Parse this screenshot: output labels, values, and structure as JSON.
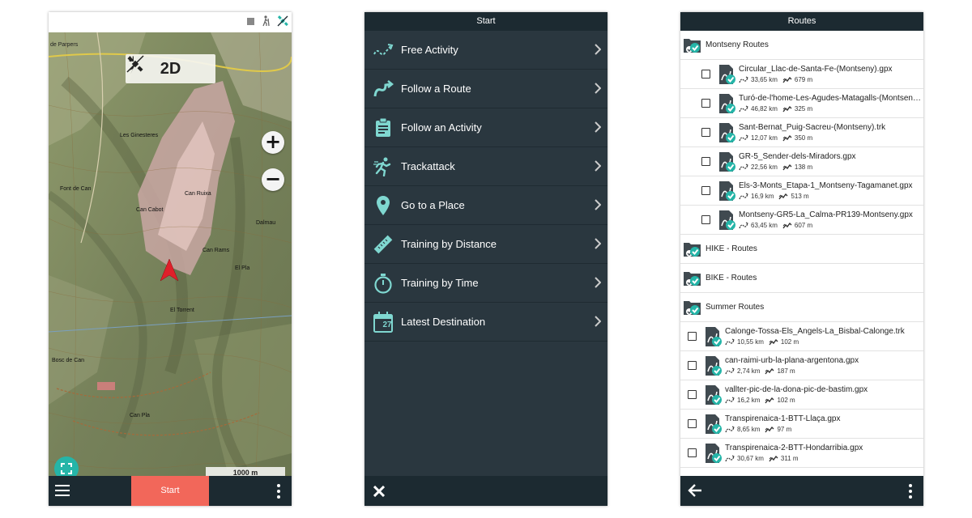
{
  "map_screen": {
    "mode": {
      "label": "2D"
    },
    "zoom_in_label": "+",
    "zoom_out_label": "−",
    "scale_label": "1000 m",
    "start_label": "Start",
    "place_labels": [
      "de Parpers",
      "Les Ginesteres",
      "Can Cabot",
      "Can Ruixa",
      "Can Rams",
      "Dalmau",
      "El Torrent",
      "Font de Can",
      "Bosc de Can",
      "Can Pla",
      "El Pla"
    ]
  },
  "start_menu": {
    "title": "Start",
    "items": [
      {
        "label": "Free Activity",
        "icon": "free-activity-icon"
      },
      {
        "label": "Follow a Route",
        "icon": "follow-route-icon"
      },
      {
        "label": "Follow an Activity",
        "icon": "clipboard-icon"
      },
      {
        "label": "Trackattack",
        "icon": "runner-icon"
      },
      {
        "label": "Go to a Place",
        "icon": "location-pin-icon"
      },
      {
        "label": "Training by Distance",
        "icon": "ruler-icon"
      },
      {
        "label": "Training by Time",
        "icon": "stopwatch-icon"
      },
      {
        "label": "Latest Destination",
        "icon": "calendar-icon"
      }
    ],
    "calendar_day": "27"
  },
  "routes_screen": {
    "title": "Routes",
    "folder_montseny": "Montseny Routes",
    "montseny_routes": [
      {
        "name": "Circular_Llac-de-Santa-Fe-(Montseny).gpx",
        "distance": "33,65 km",
        "elevation": "679 m"
      },
      {
        "name": "Turó-de-l'home-Les-Agudes-Matagalls-(Montseny)...",
        "distance": "46,82 km",
        "elevation": "325 m"
      },
      {
        "name": "Sant-Bernat_Puig-Sacreu-(Montseny).trk",
        "distance": "12,07 km",
        "elevation": "350 m"
      },
      {
        "name": "GR-5_Sender-dels-Miradors.gpx",
        "distance": "22,56 km",
        "elevation": "138 m"
      },
      {
        "name": "Els-3-Monts_Etapa-1_Montseny-Tagamanet.gpx",
        "distance": "16,9 km",
        "elevation": "513 m"
      },
      {
        "name": "Montseny-GR5-La_Calma-PR139-Montseny.gpx",
        "distance": "63,45 km",
        "elevation": "607 m"
      }
    ],
    "folder_hike": "HIKE - Routes",
    "folder_bike": "BIKE - Routes",
    "folder_summer": "Summer Routes",
    "summer_routes": [
      {
        "name": "Calonge-Tossa-Els_Angels-La_Bisbal-Calonge.trk",
        "distance": "10,55 km",
        "elevation": "102 m"
      },
      {
        "name": "can-raimi-urb-la-plana-argentona.gpx",
        "distance": "2,74 km",
        "elevation": "187 m"
      },
      {
        "name": "vallter-pic-de-la-dona-pic-de-bastim.gpx",
        "distance": "16,2 km",
        "elevation": "102 m"
      },
      {
        "name": "Transpirenaica-1-BTT-Llaça.gpx",
        "distance": "8,65 km",
        "elevation": "97 m"
      },
      {
        "name": "Transpirenaica-2-BTT-Hondarribia.gpx",
        "distance": "30,67 km",
        "elevation": "311 m"
      }
    ]
  },
  "colors": {
    "dark": "#1c2a31",
    "panel": "#2a373f",
    "accent": "#25b5a8",
    "start": "#f2675a",
    "marker": "#e0202a"
  }
}
